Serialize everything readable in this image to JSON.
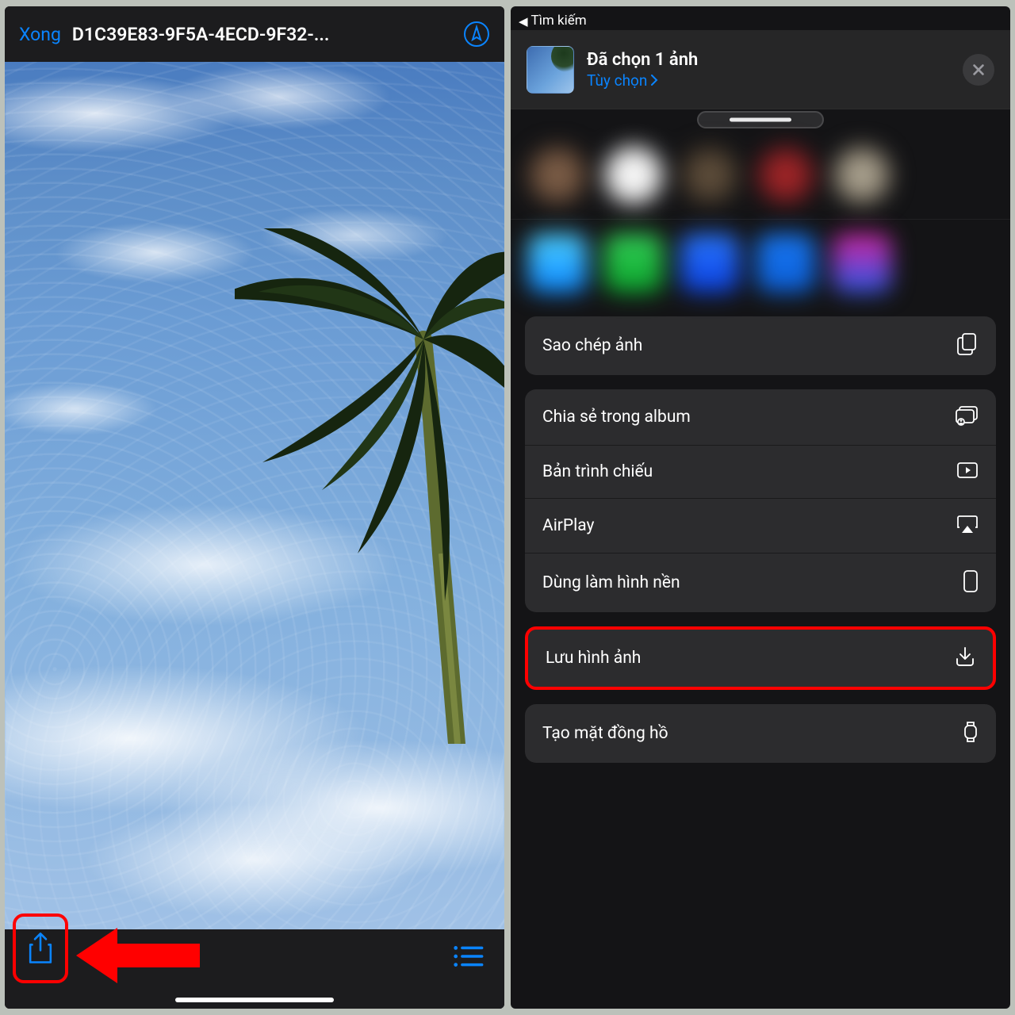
{
  "left": {
    "done_label": "Xong",
    "file_title": "D1C39E83-9F5A-4ECD-9F32-..."
  },
  "right": {
    "back_label": "Tìm kiếm",
    "sheet_title": "Đã chọn 1 ảnh",
    "sheet_subtitle": "Tùy chọn",
    "actions": {
      "copy": "Sao chép ảnh",
      "share_album": "Chia sẻ trong album",
      "slideshow": "Bản trình chiếu",
      "airplay": "AirPlay",
      "wallpaper": "Dùng làm hình nền",
      "save": "Lưu hình ảnh",
      "watchface": "Tạo mặt đồng hồ"
    }
  },
  "colors": {
    "accent": "#0a84ff",
    "highlight": "#ff0000"
  }
}
